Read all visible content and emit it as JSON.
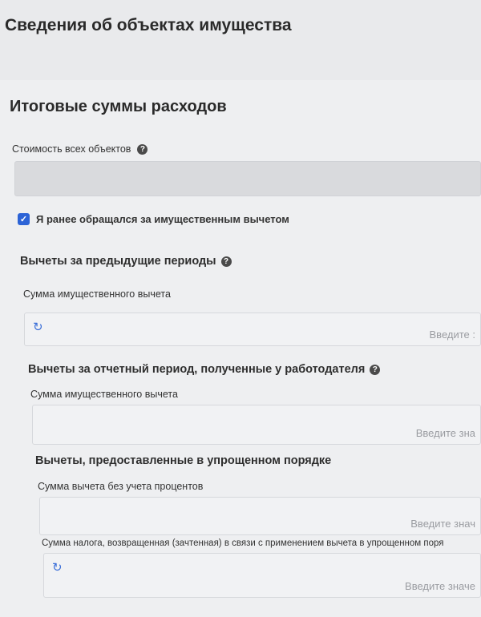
{
  "page": {
    "title": "Сведения об объектах имущества"
  },
  "totals": {
    "title": "Итоговые суммы расходов",
    "all_objects_cost_label": "Стоимость всех объектов"
  },
  "checkbox": {
    "label": "Я ранее обращался за имущественным вычетом",
    "checked": true
  },
  "previous_periods": {
    "title": "Вычеты за предыдущие периоды",
    "field_label": "Сумма имущественного вычета",
    "placeholder": "Введите :"
  },
  "employer_period": {
    "title": "Вычеты за отчетный период, полученные у работодателя",
    "field_label": "Сумма имущественного вычета",
    "placeholder": "Введите зна"
  },
  "simplified": {
    "title": "Вычеты, предоставленные в упрощенном порядке",
    "field1_label": "Сумма вычета без учета процентов",
    "field1_placeholder": "Введите знач",
    "field2_label": "Сумма налога, возвращенная (зачтенная) в связи с применением вычета в упрощенном поря",
    "field2_placeholder": "Введите значе"
  },
  "icons": {
    "help": "help-icon",
    "reset": "reset-icon",
    "check": "check-icon"
  },
  "colors": {
    "accent": "#2c63d6"
  }
}
